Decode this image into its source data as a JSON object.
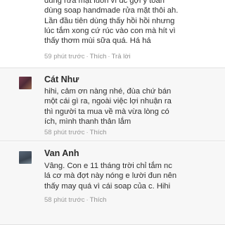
{
  "comments": [
    {
      "name": "",
      "text": "dùng rửa mặt luôn vì đc gợi ý toàn\ndùng soap handmade rửa mặt thôi ah.\nLần đầu tiên dùng thấy hồi hồi nhưng\nlúc tắm xong cứ rúc vào con mà hít vì\nthấy thơm mùi sữa quá. Há há",
      "time": "59 phút trước",
      "like": "Thích",
      "reply": "Trả lời"
    },
    {
      "name": "Cát Như",
      "text": "hihi, cảm ơn nàng nhé, đùa chứ bán\nmột cái gì ra, ngoài việc lợi nhuận ra\nthì người ta mua về mà vừa lòng có\ních, mình thanh thản lắm",
      "time": "58 phút trước",
      "like": "Thích"
    },
    {
      "name": "Van Anh",
      "text": "Vâng. Con e 11 tháng trời chỉ tắm nc\nlá cơ mà đợt này nóng e lười đun nên\nthấy may quá vì cái soap của c. Hihi",
      "time": "58 phút trước",
      "like": "Thích"
    }
  ],
  "colors": {
    "meta": "#9a9a9a",
    "alt_background": "#f7f7f7",
    "avatar_cat_nhu": "#6b3a4a",
    "avatar_van_anh": "#4a5a6a"
  }
}
